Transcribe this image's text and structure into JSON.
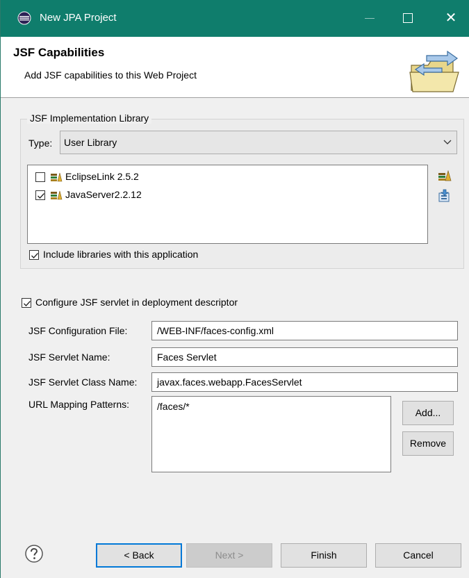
{
  "window": {
    "title": "New JPA Project"
  },
  "banner": {
    "title": "JSF Capabilities",
    "subtitle": "Add JSF capabilities to this Web Project"
  },
  "impl_group": {
    "legend": "JSF Implementation Library",
    "type_label": "Type:",
    "type_value": "User Library",
    "libraries": [
      {
        "name": "EclipseLink 2.5.2",
        "checked": false
      },
      {
        "name": "JavaServer2.2.12",
        "checked": true
      }
    ],
    "include_label": "Include libraries with this application",
    "include_checked": true
  },
  "configure": {
    "label": "Configure JSF servlet in deployment descriptor",
    "checked": true
  },
  "fields": {
    "config_file_label": "JSF Configuration File:",
    "config_file_value": "/WEB-INF/faces-config.xml",
    "servlet_name_label": "JSF Servlet Name:",
    "servlet_name_value": "Faces Servlet",
    "servlet_class_label": "JSF Servlet Class Name:",
    "servlet_class_value": "javax.faces.webapp.FacesServlet",
    "url_patterns_label": "URL Mapping Patterns:",
    "url_patterns": [
      "/faces/*"
    ]
  },
  "url_buttons": {
    "add": "Add...",
    "remove": "Remove"
  },
  "footer": {
    "back": "< Back",
    "next": "Next >",
    "finish": "Finish",
    "cancel": "Cancel"
  },
  "colors": {
    "titlebar": "#0f7d6c",
    "default_button_border": "#0078d7"
  }
}
